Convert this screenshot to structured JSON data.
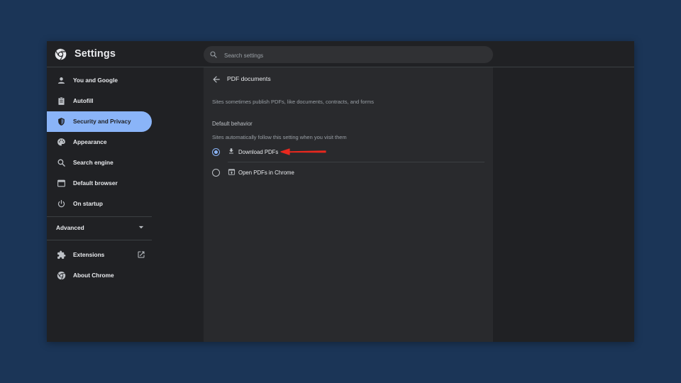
{
  "header": {
    "app_title": "Settings",
    "logo_icon": "chrome-icon",
    "search": {
      "placeholder": "Search settings",
      "value": "",
      "icon": "search-icon"
    }
  },
  "sidebar": {
    "items": [
      {
        "label": "You and Google",
        "icon": "person-icon",
        "active": false
      },
      {
        "label": "Autofill",
        "icon": "clipboard-icon",
        "active": false
      },
      {
        "label": "Security and Privacy",
        "icon": "shield-icon",
        "active": true
      },
      {
        "label": "Appearance",
        "icon": "palette-icon",
        "active": false
      },
      {
        "label": "Search engine",
        "icon": "search-icon",
        "active": false
      },
      {
        "label": "Default browser",
        "icon": "browser-icon",
        "active": false
      },
      {
        "label": "On startup",
        "icon": "power-icon",
        "active": false
      }
    ],
    "advanced": {
      "label": "Advanced",
      "icon": "chevron-down-icon"
    },
    "bottom_items": [
      {
        "label": "Extensions",
        "icon": "puzzle-icon",
        "link_icon": "open-in-new-icon"
      },
      {
        "label": "About Chrome",
        "icon": "chrome-icon"
      }
    ]
  },
  "page": {
    "title": "PDF documents",
    "back_icon": "back-arrow-icon",
    "description": "Sites sometimes publish PDFs, like documents, contracts, and forms",
    "section_heading": "Default behavior",
    "section_sub": "Sites automatically follow this setting when you visit them",
    "options": [
      {
        "label": "Download PDFs",
        "icon": "download-icon",
        "selected": true
      },
      {
        "label": "Open PDFs in Chrome",
        "icon": "open-in-browser-icon",
        "selected": false
      }
    ]
  },
  "colors": {
    "background": "#1b3557",
    "window": "#202124",
    "panel": "#292a2d",
    "accent": "#8ab4f8",
    "annotation_arrow": "#e8281e"
  }
}
